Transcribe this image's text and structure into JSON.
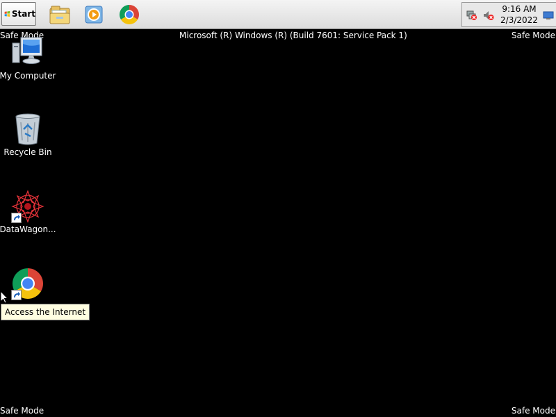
{
  "taskbar": {
    "start_label": "Start",
    "quick_launch": [
      {
        "icon": "folder-icon"
      },
      {
        "icon": "media-player-icon"
      },
      {
        "icon": "chrome-icon"
      }
    ],
    "tray": {
      "icons": [
        "network-error-icon",
        "volume-muted-icon",
        "show-desktop-icon"
      ],
      "time": "9:16 AM",
      "date": "2/3/2022"
    }
  },
  "watermarks": {
    "top_left": "Safe Mode",
    "top_center": "Microsoft (R) Windows (R) (Build 7601: Service Pack 1)",
    "top_right": "Safe Mode",
    "bottom_left": "Safe Mode",
    "bottom_right": "Safe Mode"
  },
  "desktop": {
    "icons": [
      {
        "label": "My Computer",
        "icon": "computer-icon"
      },
      {
        "label": "Recycle Bin",
        "icon": "recycle-bin-icon"
      },
      {
        "label": "DataWagon...",
        "icon": "datawagon-icon"
      },
      {
        "label": "",
        "icon": "chrome-icon"
      }
    ]
  },
  "tooltip": "Access the Internet",
  "colors": {
    "desktop_bg": "#000000",
    "tooltip_bg": "#fffee1",
    "chrome_red": "#db4437",
    "chrome_yellow": "#f4c20d",
    "chrome_green": "#0f9d58",
    "chrome_blue": "#4285f4"
  }
}
